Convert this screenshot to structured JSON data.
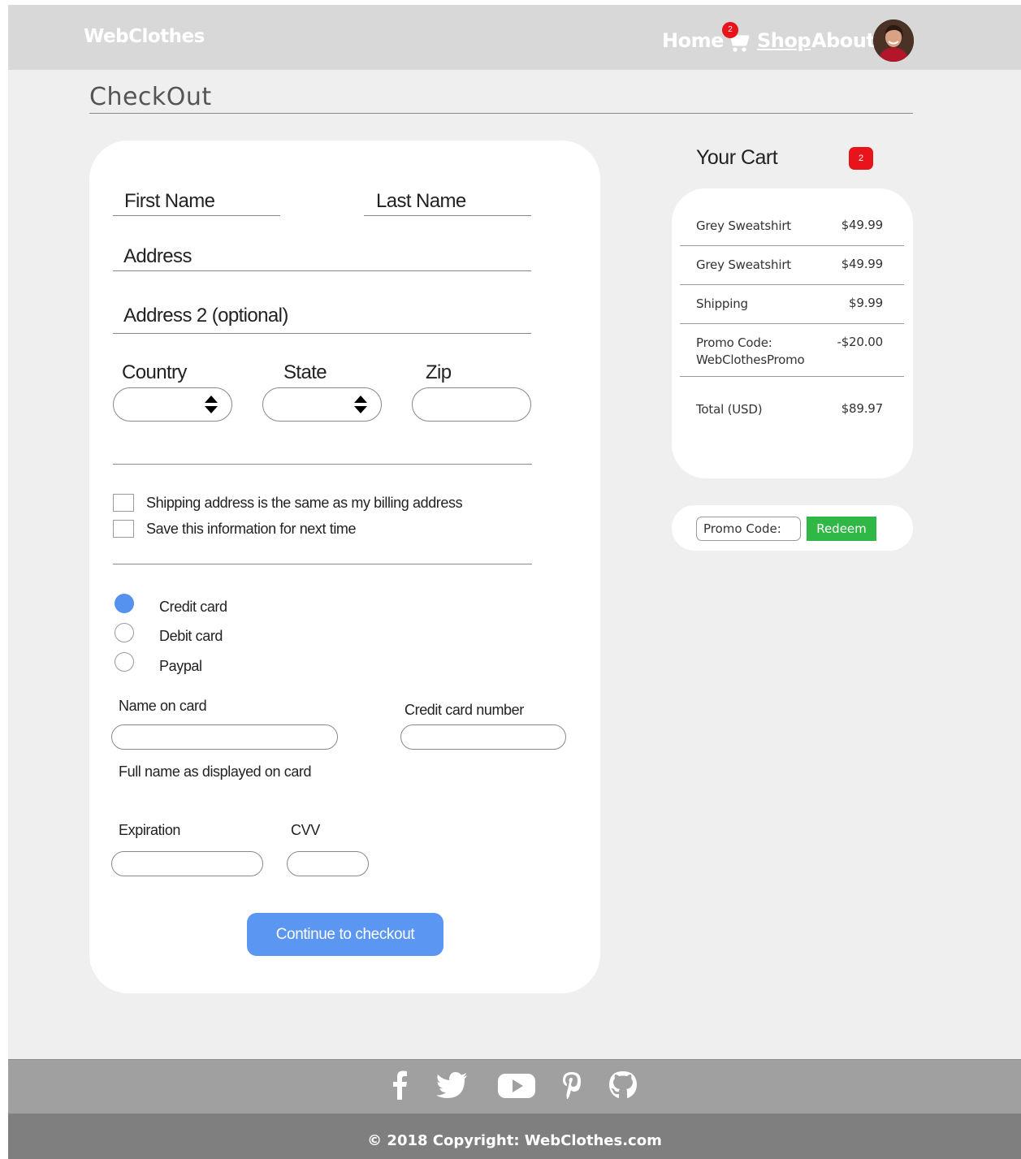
{
  "header": {
    "brand": "WebClothes",
    "nav": {
      "home": "Home",
      "shop": "Shop",
      "about": "About"
    },
    "cart_badge": "2"
  },
  "page_title": "CheckOut",
  "form": {
    "first_name": "First Name",
    "last_name": "Last Name",
    "address": "Address",
    "address2": "Address 2 (optional)",
    "country": "Country",
    "state": "State",
    "zip": "Zip",
    "same_address": "Shipping address is the same as my billing address",
    "save_info": "Save this information for next time",
    "payment": {
      "credit": "Credit card",
      "debit": "Debit card",
      "paypal": "Paypal",
      "selected": "Credit card"
    },
    "name_on_card": "Name on card",
    "card_number": "Credit card number",
    "name_hint": "Full name as displayed on card",
    "expiration": "Expiration",
    "cvv": "CVV",
    "continue": "Continue to checkout"
  },
  "cart": {
    "title": "Your Cart",
    "count": "2",
    "items": [
      {
        "name": "Grey Sweatshirt",
        "price": "$49.99"
      },
      {
        "name": "Grey Sweatshirt",
        "price": "$49.99"
      },
      {
        "name": "Shipping",
        "price": "$9.99"
      },
      {
        "name": "Promo Code:",
        "name2": "WebClothesPromo",
        "price": "-$20.00"
      }
    ],
    "total_label": "Total (USD)",
    "total": "$89.97",
    "promo_placeholder": "Promo Code:",
    "redeem": "Redeem"
  },
  "footer": {
    "social": [
      "facebook-icon",
      "twitter-icon",
      "youtube-icon",
      "pinterest-icon",
      "github-icon"
    ],
    "copyright": "© 2018 Copyright: WebClothes.com"
  },
  "colors": {
    "accent_blue": "#5b96f3",
    "badge_red": "#e8131b",
    "redeem_green": "#2fb845"
  }
}
